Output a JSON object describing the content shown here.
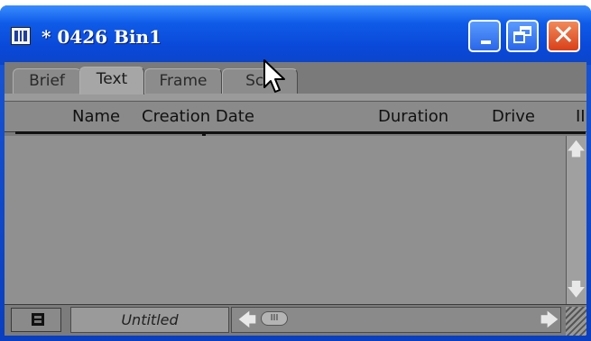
{
  "window": {
    "title": "* 0426 Bin1",
    "controls": [
      "minimize",
      "restore",
      "close"
    ],
    "close_glyph": "✕"
  },
  "tabs": [
    {
      "label": "Brief",
      "active": false
    },
    {
      "label": "Text",
      "active": true
    },
    {
      "label": "Frame",
      "active": false
    },
    {
      "label": "Scri",
      "active": false
    }
  ],
  "columns": [
    "Name",
    "Creation Date",
    "Duration",
    "Drive",
    "II"
  ],
  "rows": [],
  "bottom_bar": {
    "view_name": "Untitled",
    "thumb_glyph": "III"
  },
  "scroll_glyphs": {
    "up": "🡅",
    "down": "🡇",
    "left": "🡄",
    "right": "🡆"
  },
  "colors": {
    "titlebar_blue": "#0a48d8",
    "client_gray": "#7a7a7a",
    "close_red": "#d8401a"
  },
  "icons": [
    "bin-app-icon",
    "minimize-icon",
    "restore-icon",
    "close-icon",
    "fast-menu-icon",
    "scroll-up-icon",
    "scroll-down-icon",
    "scroll-left-icon",
    "scroll-right-icon",
    "mouse-pointer-icon"
  ]
}
